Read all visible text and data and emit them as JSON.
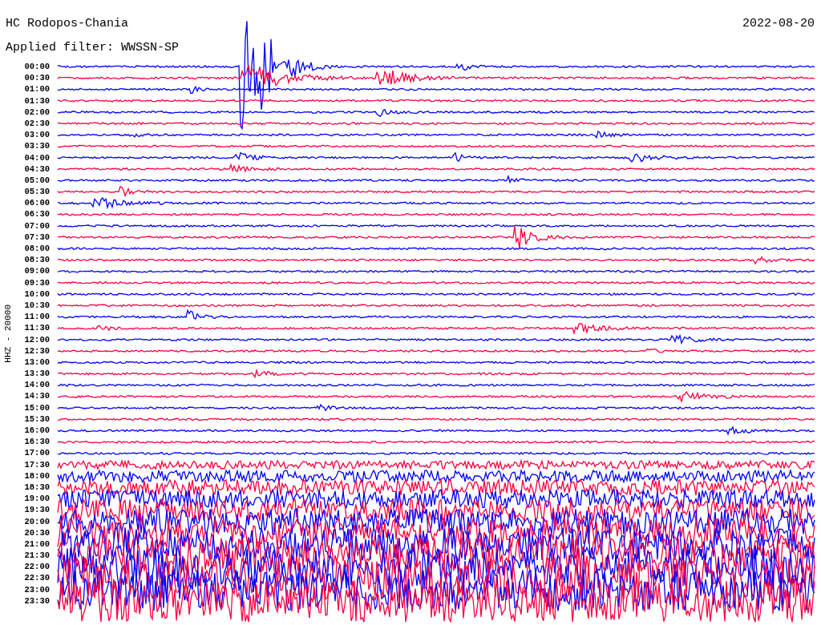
{
  "header": {
    "station": "HC Rodopos-Chania",
    "date": "2022-08-20",
    "filter": "Applied filter: WWSSN-SP"
  },
  "channel_label": "HHZ - 20000",
  "rows": [
    {
      "time": "00:00",
      "color": "#0000ff"
    },
    {
      "time": "00:30",
      "color": "#ff0040"
    },
    {
      "time": "01:00",
      "color": "#0000ff"
    },
    {
      "time": "01:30",
      "color": "#ff0040"
    },
    {
      "time": "02:00",
      "color": "#0000ff"
    },
    {
      "time": "02:30",
      "color": "#ff0040"
    },
    {
      "time": "03:00",
      "color": "#0000ff"
    },
    {
      "time": "03:30",
      "color": "#ff0040"
    },
    {
      "time": "04:00",
      "color": "#0000ff"
    },
    {
      "time": "04:30",
      "color": "#ff0040"
    },
    {
      "time": "05:00",
      "color": "#0000ff"
    },
    {
      "time": "05:30",
      "color": "#ff0040"
    },
    {
      "time": "06:00",
      "color": "#0000ff"
    },
    {
      "time": "06:30",
      "color": "#ff0040"
    },
    {
      "time": "07:00",
      "color": "#0000ff"
    },
    {
      "time": "07:30",
      "color": "#ff0040"
    },
    {
      "time": "08:00",
      "color": "#0000ff"
    },
    {
      "time": "08:30",
      "color": "#ff0040"
    },
    {
      "time": "09:00",
      "color": "#0000ff"
    },
    {
      "time": "09:30",
      "color": "#ff0040"
    },
    {
      "time": "10:00",
      "color": "#0000ff"
    },
    {
      "time": "10:30",
      "color": "#ff0040"
    },
    {
      "time": "11:00",
      "color": "#0000ff"
    },
    {
      "time": "11:30",
      "color": "#ff0040"
    },
    {
      "time": "12:00",
      "color": "#0000ff"
    },
    {
      "time": "12:30",
      "color": "#ff0040"
    },
    {
      "time": "13:00",
      "color": "#0000ff"
    },
    {
      "time": "13:30",
      "color": "#ff0040"
    },
    {
      "time": "14:00",
      "color": "#0000ff"
    },
    {
      "time": "14:30",
      "color": "#ff0040"
    },
    {
      "time": "15:00",
      "color": "#0000ff"
    },
    {
      "time": "15:30",
      "color": "#ff0040"
    },
    {
      "time": "16:00",
      "color": "#0000ff"
    },
    {
      "time": "16:30",
      "color": "#ff0040"
    },
    {
      "time": "17:00",
      "color": "#0000ff"
    },
    {
      "time": "17:30",
      "color": "#ff0040"
    },
    {
      "time": "18:00",
      "color": "#0000ff"
    },
    {
      "time": "18:30",
      "color": "#ff0040"
    },
    {
      "time": "19:00",
      "color": "#0000ff"
    },
    {
      "time": "19:30",
      "color": "#ff0040"
    },
    {
      "time": "20:00",
      "color": "#0000ff"
    },
    {
      "time": "20:30",
      "color": "#ff0040"
    },
    {
      "time": "21:00",
      "color": "#0000ff"
    },
    {
      "time": "21:30",
      "color": "#ff0040"
    },
    {
      "time": "22:00",
      "color": "#0000ff"
    },
    {
      "time": "22:30",
      "color": "#ff0040"
    },
    {
      "time": "23:00",
      "color": "#0000ff"
    },
    {
      "time": "23:30",
      "color": "#ff0040"
    }
  ]
}
